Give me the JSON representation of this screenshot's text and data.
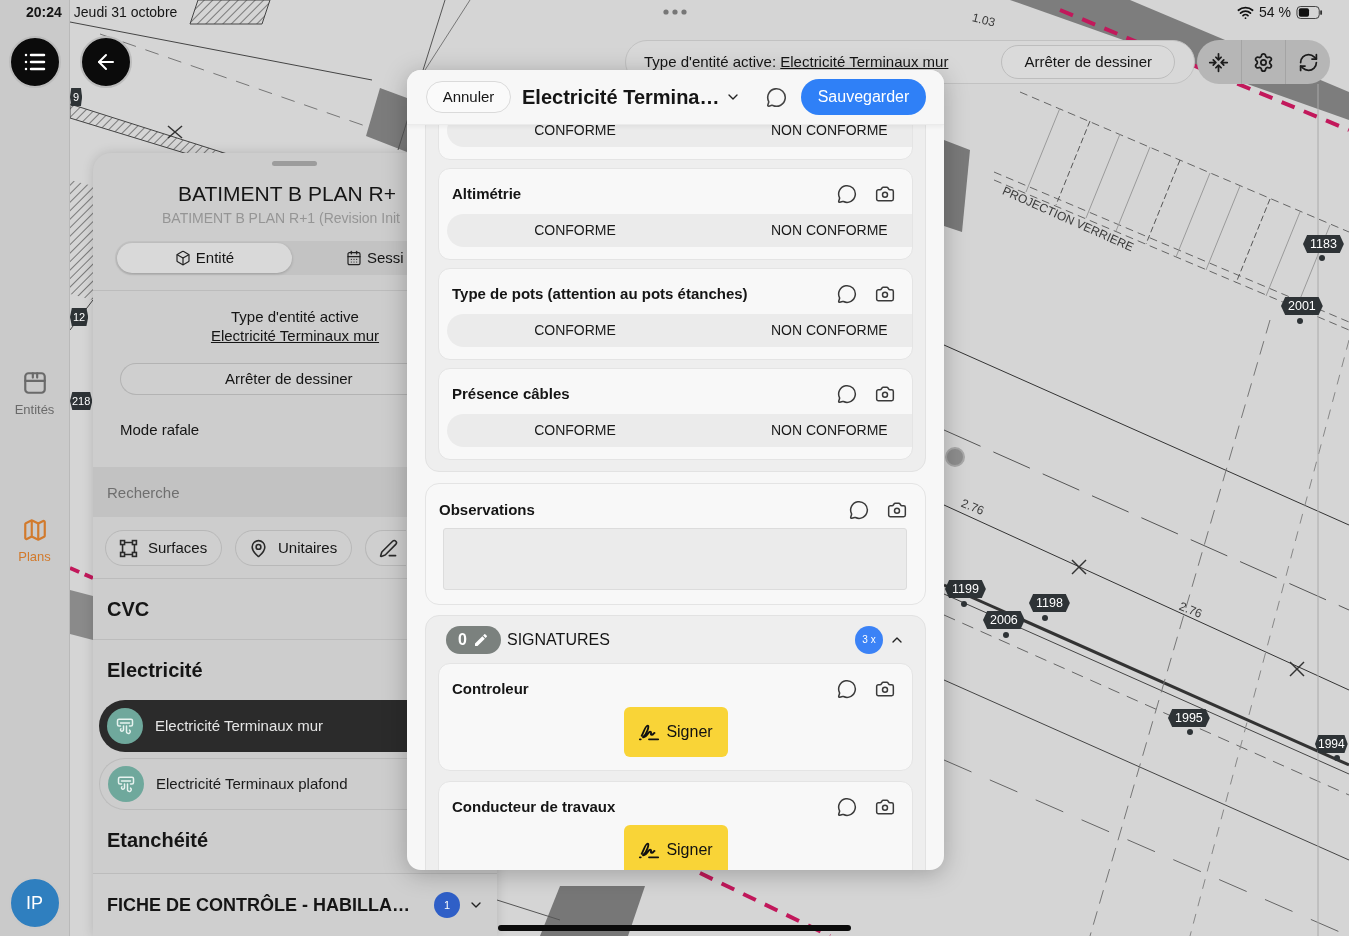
{
  "status_bar": {
    "time": "20:24",
    "date": "Jeudi 31 octobre",
    "battery": "54 %"
  },
  "rail": {
    "items": [
      {
        "kind": "entities",
        "label": "Entités",
        "selected": false
      },
      {
        "kind": "plans",
        "label": "Plans",
        "selected": true
      }
    ],
    "avatar": "IP"
  },
  "plan": {
    "labels": [
      "1.03",
      "PROJECTION VERRIERE",
      "2.76",
      "2.76"
    ],
    "pins": [
      {
        "label": "9"
      },
      {
        "label": "1183"
      },
      {
        "label": "2001"
      },
      {
        "label": "12"
      },
      {
        "label": "218"
      },
      {
        "label": "1199"
      },
      {
        "label": "1198"
      },
      {
        "label": "2006"
      },
      {
        "label": "1995"
      },
      {
        "label": "1994"
      }
    ]
  },
  "top_bar": {
    "active_type_label": "Type d'entité active:",
    "active_type_value": "Electricité Terminaux mur",
    "stop_button": "Arrêter de dessiner",
    "tools": [
      {
        "kind": "recenter"
      },
      {
        "kind": "settings"
      },
      {
        "kind": "refresh"
      }
    ]
  },
  "panel": {
    "title": "BATIMENT B PLAN R+",
    "subtitle": "BATIMENT B PLAN R+1 (Revision Init",
    "tabs": [
      {
        "kind": "entity",
        "label": "Entité",
        "selected": true
      },
      {
        "kind": "session",
        "label": "Sessi",
        "selected": false
      }
    ],
    "active_type_label": "Type d'entité active",
    "active_type_value": "Electricité Terminaux mur",
    "stop_button": "Arrêter de dessiner",
    "burst_mode": "Mode rafale",
    "search": {
      "placeholder": "Recherche"
    },
    "filters": [
      {
        "kind": "surfaces",
        "label": "Surfaces"
      },
      {
        "kind": "units",
        "label": "Unitaires"
      },
      {
        "kind": "draw"
      }
    ],
    "groups": [
      {
        "title": "CVC"
      },
      {
        "title": "Electricité",
        "items": [
          {
            "label": "Electricité Terminaux mur",
            "selected": true
          },
          {
            "label": "Electricité Terminaux plafond",
            "selected": false
          }
        ]
      },
      {
        "title": "Etanchéité"
      }
    ],
    "form_bar": {
      "title": "FICHE DE CONTRÔLE - HABILLA…",
      "badge": "1",
      "expanded": false
    }
  },
  "modal": {
    "cancel": "Annuler",
    "title": "Electricité Termina…",
    "save": "Sauvegarder",
    "checks": [
      {
        "options": [
          {
            "label": "CONFORME",
            "selected": false
          },
          {
            "label": "NON CONFORME",
            "selected": false
          }
        ]
      },
      {
        "title": "Altimétrie",
        "options": [
          {
            "label": "CONFORME",
            "selected": false
          },
          {
            "label": "NON CONFORME",
            "selected": false
          }
        ]
      },
      {
        "title": "Type de pots (attention au pots étanches)",
        "options": [
          {
            "label": "CONFORME",
            "selected": false
          },
          {
            "label": "NON CONFORME",
            "selected": false
          }
        ]
      },
      {
        "title": "Présence câbles",
        "options": [
          {
            "label": "CONFORME",
            "selected": false
          },
          {
            "label": "NON CONFORME",
            "selected": false
          }
        ]
      }
    ],
    "observations": {
      "title": "Observations"
    },
    "signatures": {
      "count": "0",
      "title": "SIGNATURES",
      "badge": "3 x",
      "expanded": true,
      "signers": [
        {
          "title": "Controleur",
          "button": "Signer"
        },
        {
          "title": "Conducteur de travaux",
          "button": "Signer"
        }
      ]
    }
  }
}
